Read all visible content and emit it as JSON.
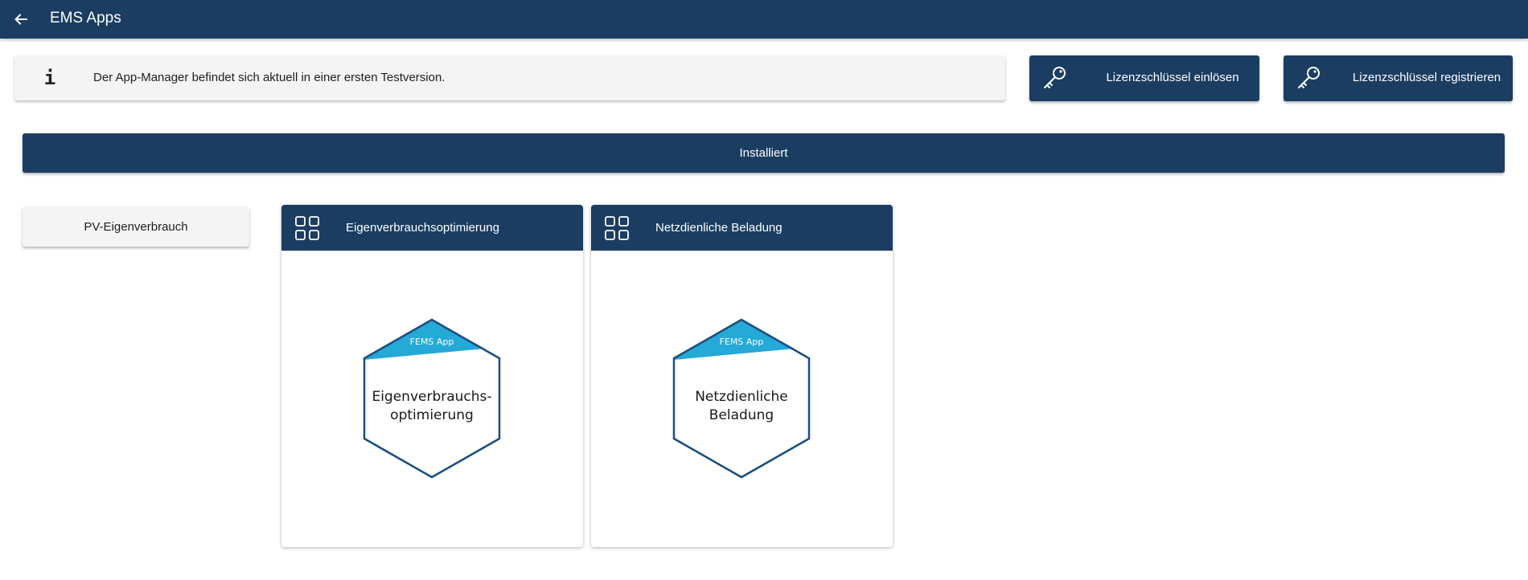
{
  "header": {
    "title": "EMS Apps",
    "back_icon": "arrow-left-icon"
  },
  "info": {
    "icon": "info-icon",
    "icon_glyph": "i",
    "text": "Der App-Manager befindet sich aktuell in einer ersten Testversion."
  },
  "license_buttons": {
    "redeem_label": "Lizenzschlüssel einlösen",
    "register_label": "Lizenzschlüssel registrieren",
    "icon": "key-icon"
  },
  "section": {
    "installed_label": "Installiert"
  },
  "categories": [
    {
      "label": "PV-Eigenverbrauch"
    }
  ],
  "apps": [
    {
      "title": "Eigenverbrauchsoptimierung",
      "badge": "FEMS App",
      "hex_lines": [
        "Eigenverbrauchs-",
        "optimierung"
      ],
      "icon": "grid-icon"
    },
    {
      "title": "Netzdienliche Beladung",
      "badge": "FEMS App",
      "hex_lines": [
        "Netzdienliche",
        "Beladung"
      ],
      "icon": "grid-icon"
    }
  ],
  "colors": {
    "primary": "#1b3d61",
    "badge_accent": "#25a9d6",
    "hex_stroke": "#1b4d80",
    "surface": "#f4f4f4"
  }
}
